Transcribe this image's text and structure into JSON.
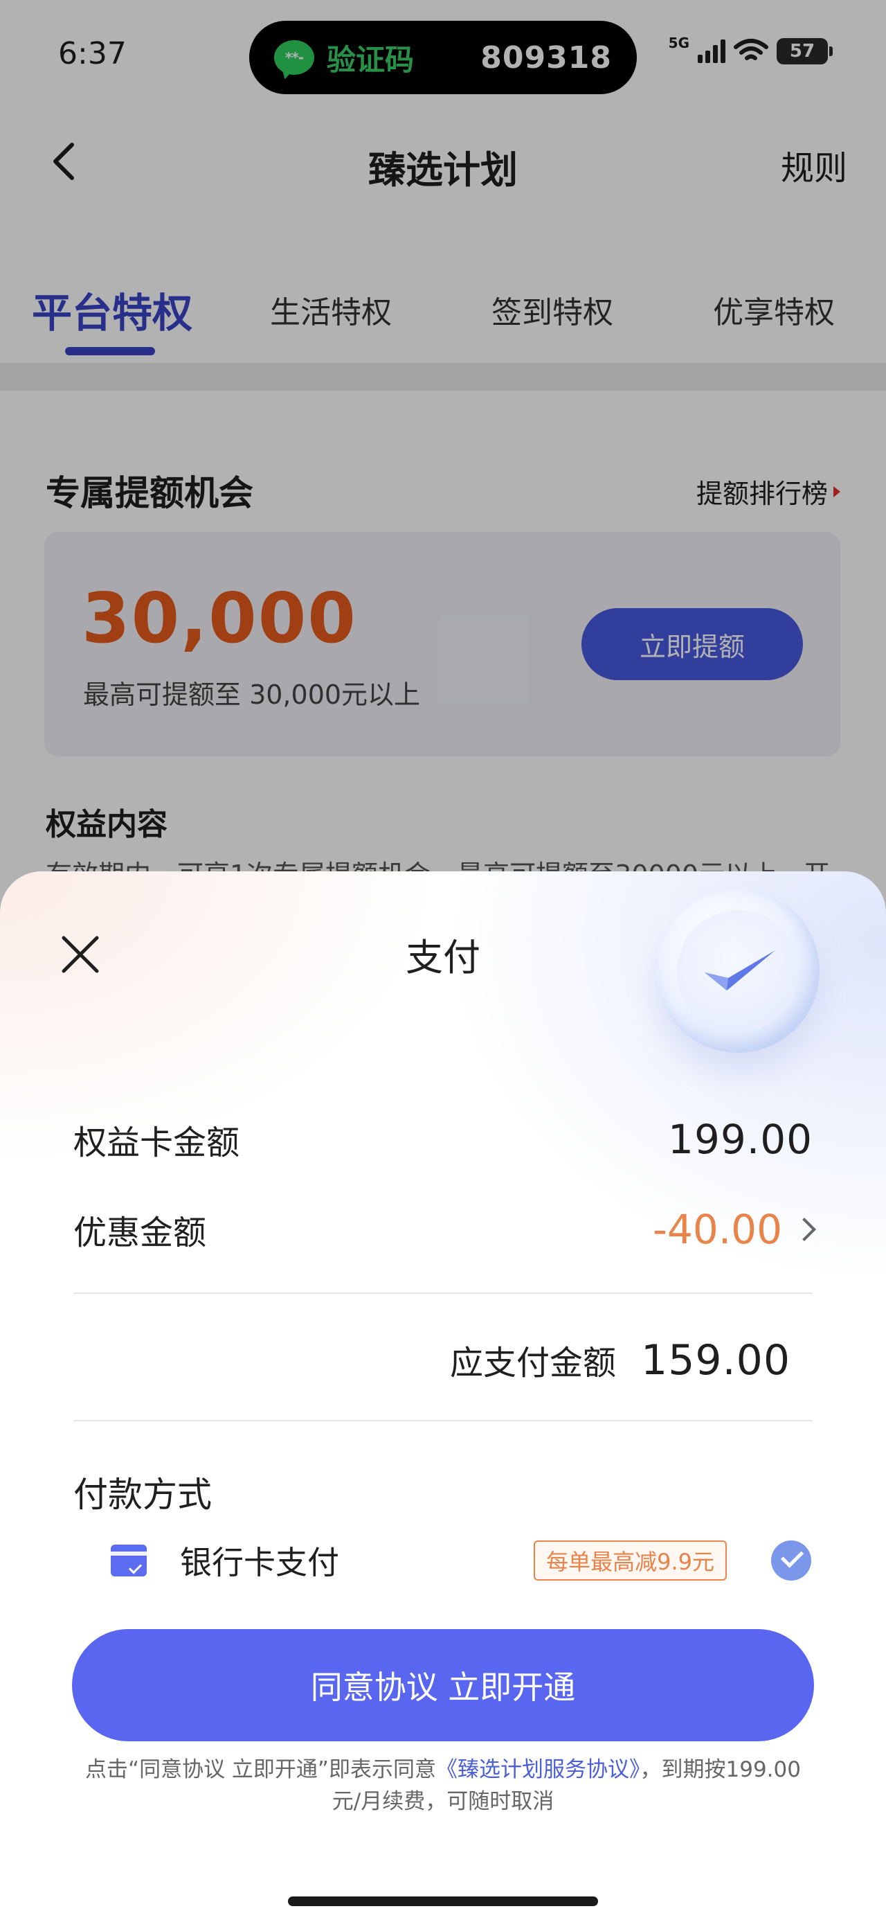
{
  "status_bar": {
    "time": "6:37",
    "sms_label": "验证码",
    "sms_code": "809318",
    "network": "5G",
    "battery": "57"
  },
  "nav": {
    "title": "臻选计划",
    "rule": "规则"
  },
  "tabs": [
    {
      "label": "平台特权",
      "active": true
    },
    {
      "label": "生活特权",
      "active": false
    },
    {
      "label": "签到特权",
      "active": false
    },
    {
      "label": "优享特权",
      "active": false
    }
  ],
  "quota": {
    "section_title": "专属提额机会",
    "rank_link": "提额排行榜",
    "amount": "30,000",
    "desc": "最高可提额至 30,000元以上",
    "button": "立即提额"
  },
  "benefit": {
    "title": "权益内容",
    "text": "有效期内，可享1次专属提额机会，最高可提额至30000元以上，开"
  },
  "payment": {
    "title": "支付",
    "card_amount_label": "权益卡金额",
    "card_amount_value": "199.00",
    "discount_label": "优惠金额",
    "discount_value": "-40.00",
    "payable_label": "应支付金额",
    "payable_value": "159.00",
    "method_title": "付款方式",
    "bank_label": "银行卡支付",
    "promo_badge": "每单最高减9.9元",
    "cta": "同意协议 立即开通",
    "legal_prefix": "点击“同意协议 立即开通”即表示同意",
    "legal_link": "《臻选计划服务协议》",
    "legal_suffix": "，到期按199.00元/月续费，可随时取消"
  },
  "colors": {
    "accent": "#4759e0",
    "cta": "#5966f0",
    "discount": "#e8834a",
    "quota_amount": "#e45b1c"
  }
}
